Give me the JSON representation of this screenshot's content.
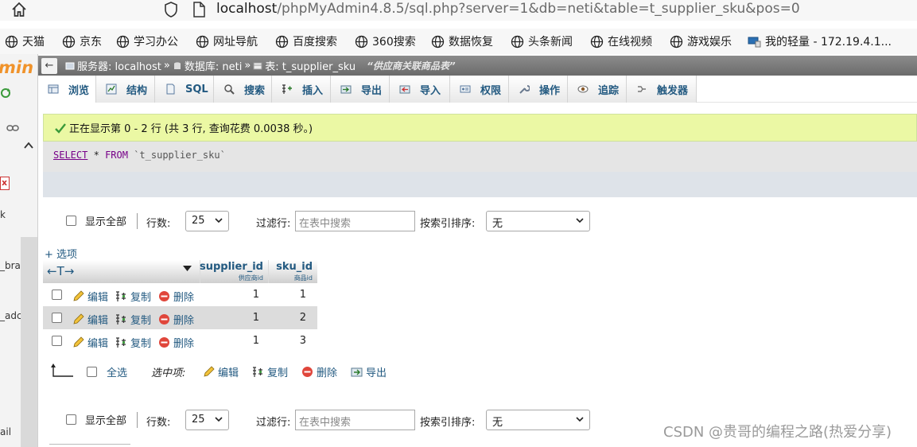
{
  "browser": {
    "url_host": "localhost",
    "url_path": "/phpMyAdmin4.8.5/sql.php?server=1&db=neti&table=t_supplier_sku&pos=0",
    "bookmarks": [
      {
        "label": "天猫"
      },
      {
        "label": "京东"
      },
      {
        "label": "学习办公"
      },
      {
        "label": "网址导航"
      },
      {
        "label": "百度搜索"
      },
      {
        "label": "360搜索"
      },
      {
        "label": "数据恢复"
      },
      {
        "label": "头条新闻"
      },
      {
        "label": "在线视频"
      },
      {
        "label": "游戏娱乐"
      },
      {
        "label": "我的轻量 - 172.19.4.1..."
      }
    ]
  },
  "leftnav": {
    "logo": "min",
    "fragments": [
      "x",
      "k",
      "_bran",
      "_adc",
      "ail"
    ]
  },
  "breadcrumb": {
    "server": "服务器: localhost",
    "database": "数据库: neti",
    "table": "表: t_supplier_sku",
    "comment": "“供应商关联商品表”"
  },
  "tabs": [
    {
      "label": "浏览",
      "icon": "browse-icon"
    },
    {
      "label": "结构",
      "icon": "structure-icon"
    },
    {
      "label": "SQL",
      "icon": "sql-icon"
    },
    {
      "label": "搜索",
      "icon": "search-icon"
    },
    {
      "label": "插入",
      "icon": "insert-icon"
    },
    {
      "label": "导出",
      "icon": "export-icon"
    },
    {
      "label": "导入",
      "icon": "import-icon"
    },
    {
      "label": "权限",
      "icon": "privileges-icon"
    },
    {
      "label": "操作",
      "icon": "wrench-icon"
    },
    {
      "label": "追踪",
      "icon": "eye-icon"
    },
    {
      "label": "触发器",
      "icon": "triggers-icon"
    }
  ],
  "message": {
    "success": "正在显示第 0 - 2 行 (共 3 行, 查询花费 0.0038 秒。)"
  },
  "sql": {
    "select": "SELECT",
    "star": "*",
    "from": "FROM",
    "table": "`t_supplier_sku`"
  },
  "nav": {
    "show_all": "显示全部",
    "rows_label": "行数:",
    "rows_value": "25",
    "filter_label": "过滤行:",
    "filter_placeholder": "在表中搜索",
    "sort_label": "按索引排序:",
    "sort_value": "无"
  },
  "options_link": "+ 选项",
  "table": {
    "columns": [
      {
        "name": "supplier_id",
        "comment": "供应商id"
      },
      {
        "name": "sku_id",
        "comment": "商品id"
      }
    ],
    "actions": {
      "edit": "编辑",
      "copy": "复制",
      "delete": "删除"
    },
    "rows": [
      {
        "supplier_id": "1",
        "sku_id": "1"
      },
      {
        "supplier_id": "1",
        "sku_id": "2"
      },
      {
        "supplier_id": "1",
        "sku_id": "3"
      }
    ]
  },
  "bulk": {
    "check_all": "全选",
    "with_selected": "选中项:",
    "edit": "编辑",
    "copy": "复制",
    "delete": "删除",
    "export": "导出"
  },
  "watermark": "CSDN @贵哥的编程之路(热爱分享)"
}
